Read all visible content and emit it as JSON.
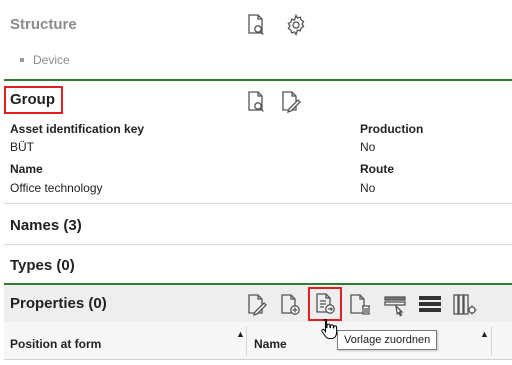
{
  "structure": {
    "title": "Structure",
    "items": [
      {
        "label": "Device"
      }
    ]
  },
  "group": {
    "title": "Group",
    "fields": {
      "asset_key_label": "Asset identification key",
      "asset_key_value": "BÜT",
      "name_label": "Name",
      "name_value": "Office technology",
      "production_label": "Production",
      "production_value": "No",
      "route_label": "Route",
      "route_value": "No"
    }
  },
  "names": {
    "title": "Names (3)"
  },
  "types": {
    "title": "Types (0)"
  },
  "properties": {
    "title": "Properties (0)",
    "columns": [
      "Position at form",
      "Name"
    ],
    "tooltip": "Vorlage zuordnen"
  },
  "colors": {
    "section_line": "#2e7d32",
    "highlight": "#e02020",
    "muted_text": "#8c8c8c"
  }
}
